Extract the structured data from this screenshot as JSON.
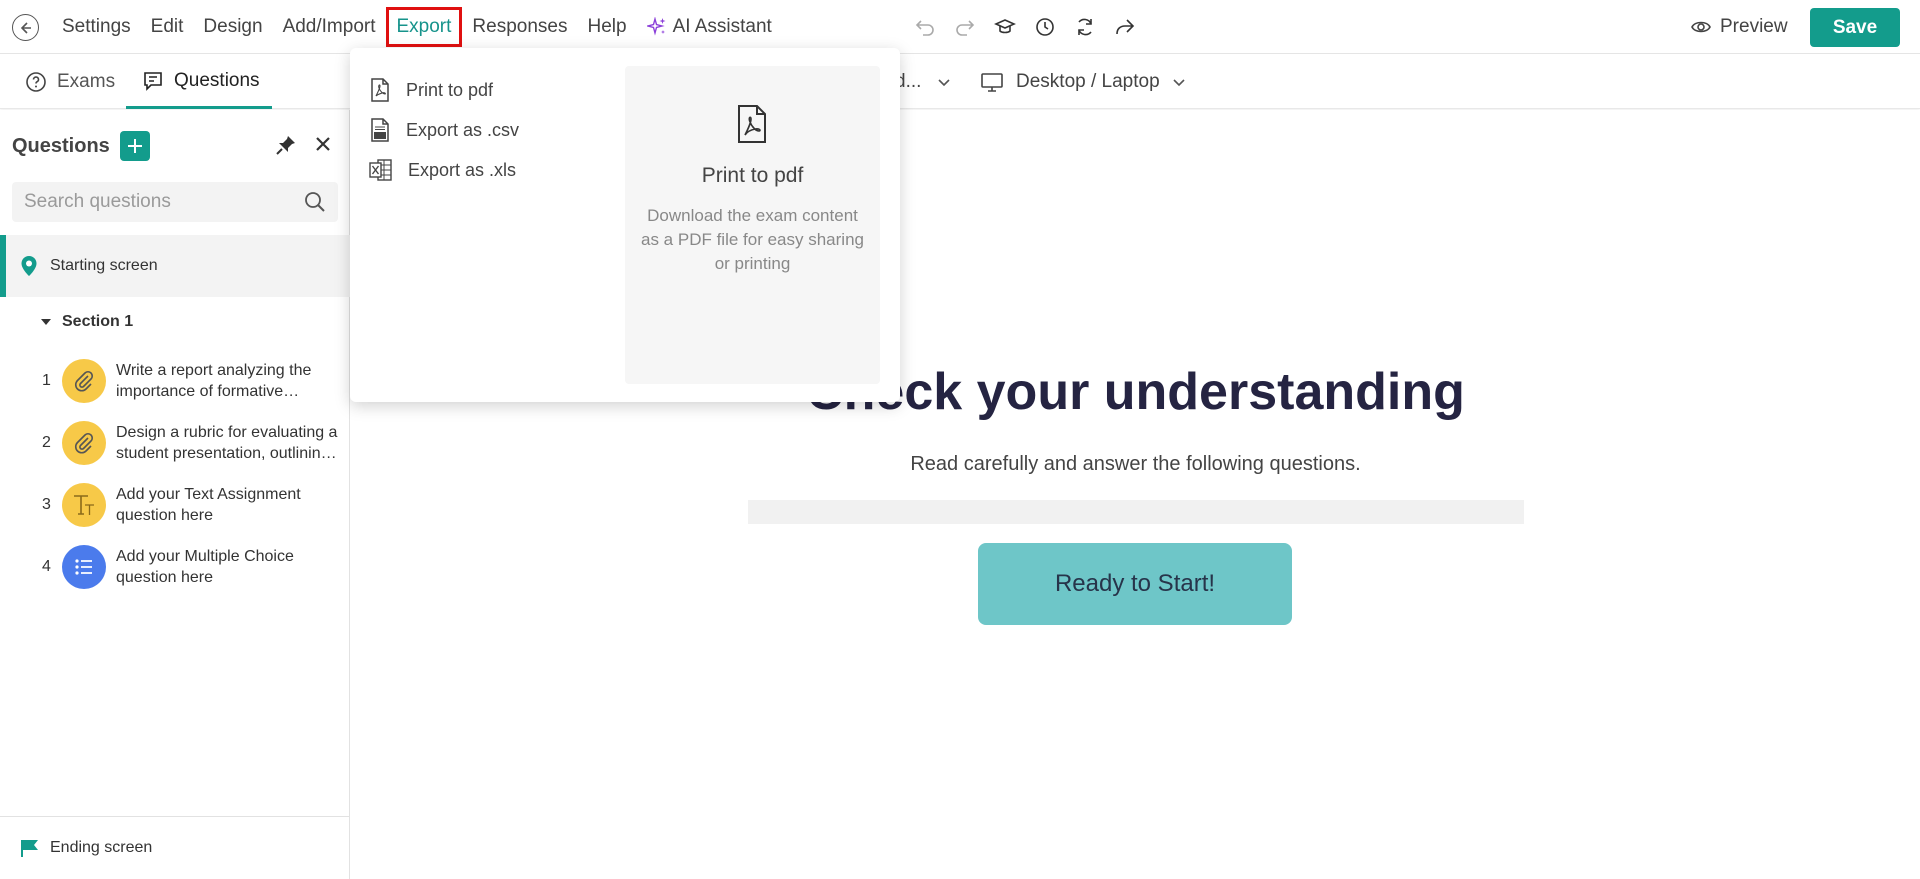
{
  "menu": {
    "items": [
      "Settings",
      "Edit",
      "Design",
      "Add/Import",
      "Export",
      "Responses",
      "Help"
    ],
    "ai_label": "AI Assistant",
    "preview_label": "Preview",
    "save_label": "Save"
  },
  "subbar": {
    "tabs": [
      {
        "label": "Exams",
        "icon": "question-circle-icon"
      },
      {
        "label": "Questions",
        "icon": "chat-list-icon"
      }
    ],
    "partial_label": "d...",
    "device_label": "Desktop / Laptop"
  },
  "sidebar": {
    "title": "Questions",
    "search_placeholder": "Search questions",
    "starting_screen": "Starting screen",
    "section_label": "Section 1",
    "questions": [
      {
        "num": "1",
        "text": "Write a report analyzing the importance of formative…",
        "icon": "paperclip-icon",
        "color": "#f7c948"
      },
      {
        "num": "2",
        "text": "Design a rubric for evaluating a student presentation, outlinin…",
        "icon": "paperclip-icon",
        "color": "#f7c948"
      },
      {
        "num": "3",
        "text": "Add your Text Assignment question here",
        "icon": "text-icon",
        "color": "#f7c948"
      },
      {
        "num": "4",
        "text": "Add your Multiple Choice question here",
        "icon": "list-icon",
        "color": "#4b7bec"
      }
    ],
    "ending_screen": "Ending screen"
  },
  "main": {
    "title": "Check your understanding",
    "subtitle": "Read carefully and answer the following questions.",
    "start_button": "Ready to Start!"
  },
  "export_menu": {
    "items": [
      {
        "label": "Print to pdf",
        "icon": "pdf-file-icon"
      },
      {
        "label": "Export as .csv",
        "icon": "csv-file-icon"
      },
      {
        "label": "Export as .xls",
        "icon": "xls-file-icon"
      }
    ],
    "preview_title": "Print to pdf",
    "preview_description": "Download the exam content as a PDF file for easy sharing or printing"
  },
  "colors": {
    "brand": "#139c8c",
    "highlight": "#e01010",
    "start_button": "#6ec6c8"
  }
}
